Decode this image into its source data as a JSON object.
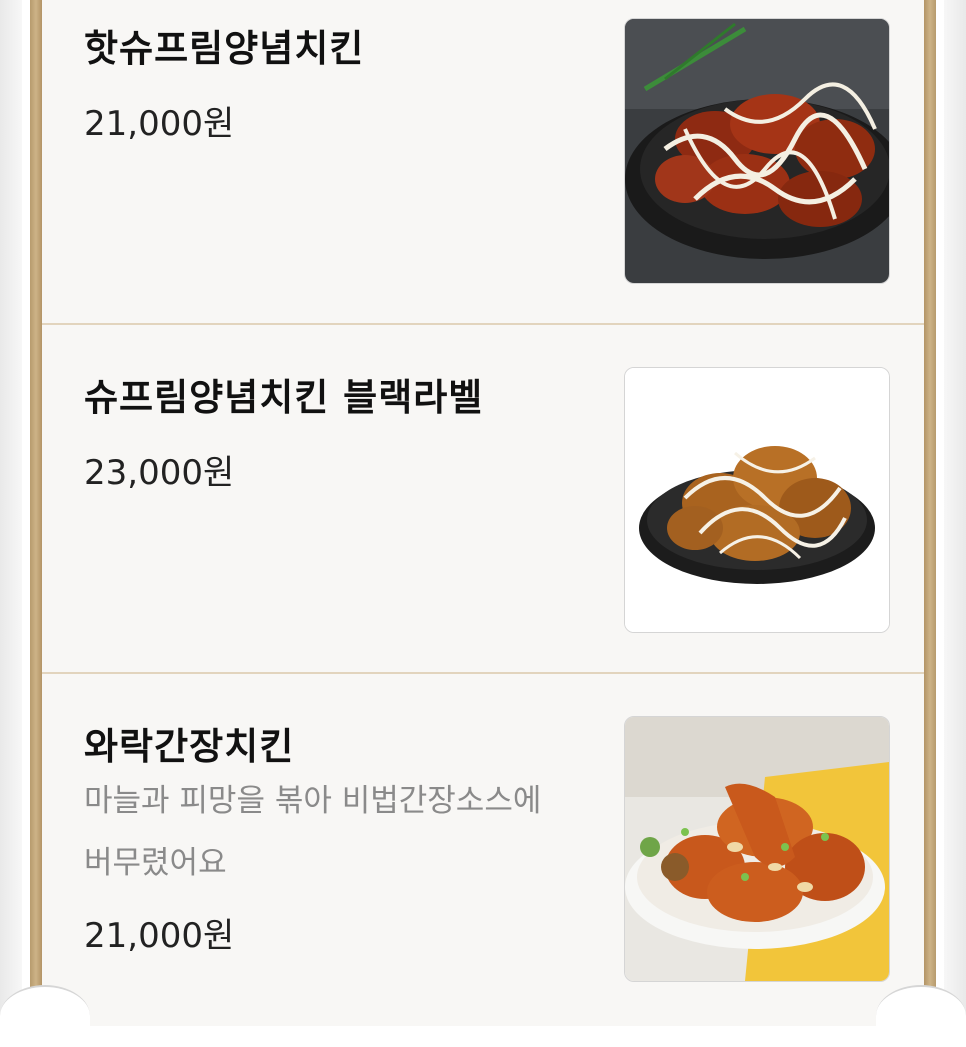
{
  "menu": {
    "items": [
      {
        "name": "핫슈프림양념치킨",
        "price": "21,000원",
        "image_icon": "hot-supreme-chicken-photo"
      },
      {
        "name": "슈프림양념치킨 블랙라벨",
        "price": "23,000원",
        "image_icon": "supreme-black-label-chicken-photo"
      },
      {
        "name": "와락간장치킨",
        "description_line1": "마늘과 피망을 볶아 비법간장소스에",
        "description_line2": "버무렸어요",
        "price": "21,000원",
        "image_icon": "soy-garlic-chicken-photo"
      }
    ]
  },
  "colors": {
    "frame_gold": "#c2a77b",
    "divider": "#e2d4bd",
    "card_bg": "#f8f7f5",
    "name_text": "#111111",
    "price_text": "#222222",
    "desc_text": "#8a8a8a"
  }
}
